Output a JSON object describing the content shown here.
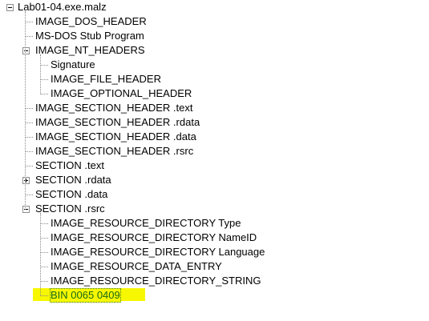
{
  "tree": {
    "root": {
      "label": "Lab01-04.exe.malz",
      "expanded": true
    },
    "items": [
      {
        "id": "dos-header",
        "label": "IMAGE_DOS_HEADER"
      },
      {
        "id": "dos-stub",
        "label": "MS-DOS Stub Program"
      },
      {
        "id": "nt-headers",
        "label": "IMAGE_NT_HEADERS",
        "expanded": true,
        "children": [
          {
            "id": "signature",
            "label": "Signature"
          },
          {
            "id": "file-header",
            "label": "IMAGE_FILE_HEADER"
          },
          {
            "id": "optional-header",
            "label": "IMAGE_OPTIONAL_HEADER"
          }
        ]
      },
      {
        "id": "section-header-text",
        "label": "IMAGE_SECTION_HEADER .text"
      },
      {
        "id": "section-header-rdata",
        "label": "IMAGE_SECTION_HEADER .rdata"
      },
      {
        "id": "section-header-data",
        "label": "IMAGE_SECTION_HEADER .data"
      },
      {
        "id": "section-header-rsrc",
        "label": "IMAGE_SECTION_HEADER .rsrc"
      },
      {
        "id": "section-text",
        "label": "SECTION .text"
      },
      {
        "id": "section-rdata",
        "label": "SECTION .rdata",
        "expanded": false
      },
      {
        "id": "section-data",
        "label": "SECTION .data"
      },
      {
        "id": "section-rsrc",
        "label": "SECTION .rsrc",
        "expanded": true,
        "children": [
          {
            "id": "res-dir-type",
            "label": "IMAGE_RESOURCE_DIRECTORY Type"
          },
          {
            "id": "res-dir-nameid",
            "label": "IMAGE_RESOURCE_DIRECTORY NameID"
          },
          {
            "id": "res-dir-language",
            "label": "IMAGE_RESOURCE_DIRECTORY Language"
          },
          {
            "id": "res-data-entry",
            "label": "IMAGE_RESOURCE_DATA_ENTRY"
          },
          {
            "id": "res-dir-string",
            "label": "IMAGE_RESOURCE_DIRECTORY_STRING"
          },
          {
            "id": "bin-0065-0409",
            "label": "BIN  0065  0409",
            "selected": true
          }
        ]
      }
    ]
  },
  "colors": {
    "highlight": "#f7f700",
    "selected_text": "#1a6a1a",
    "connector": "#8a8a8a"
  }
}
